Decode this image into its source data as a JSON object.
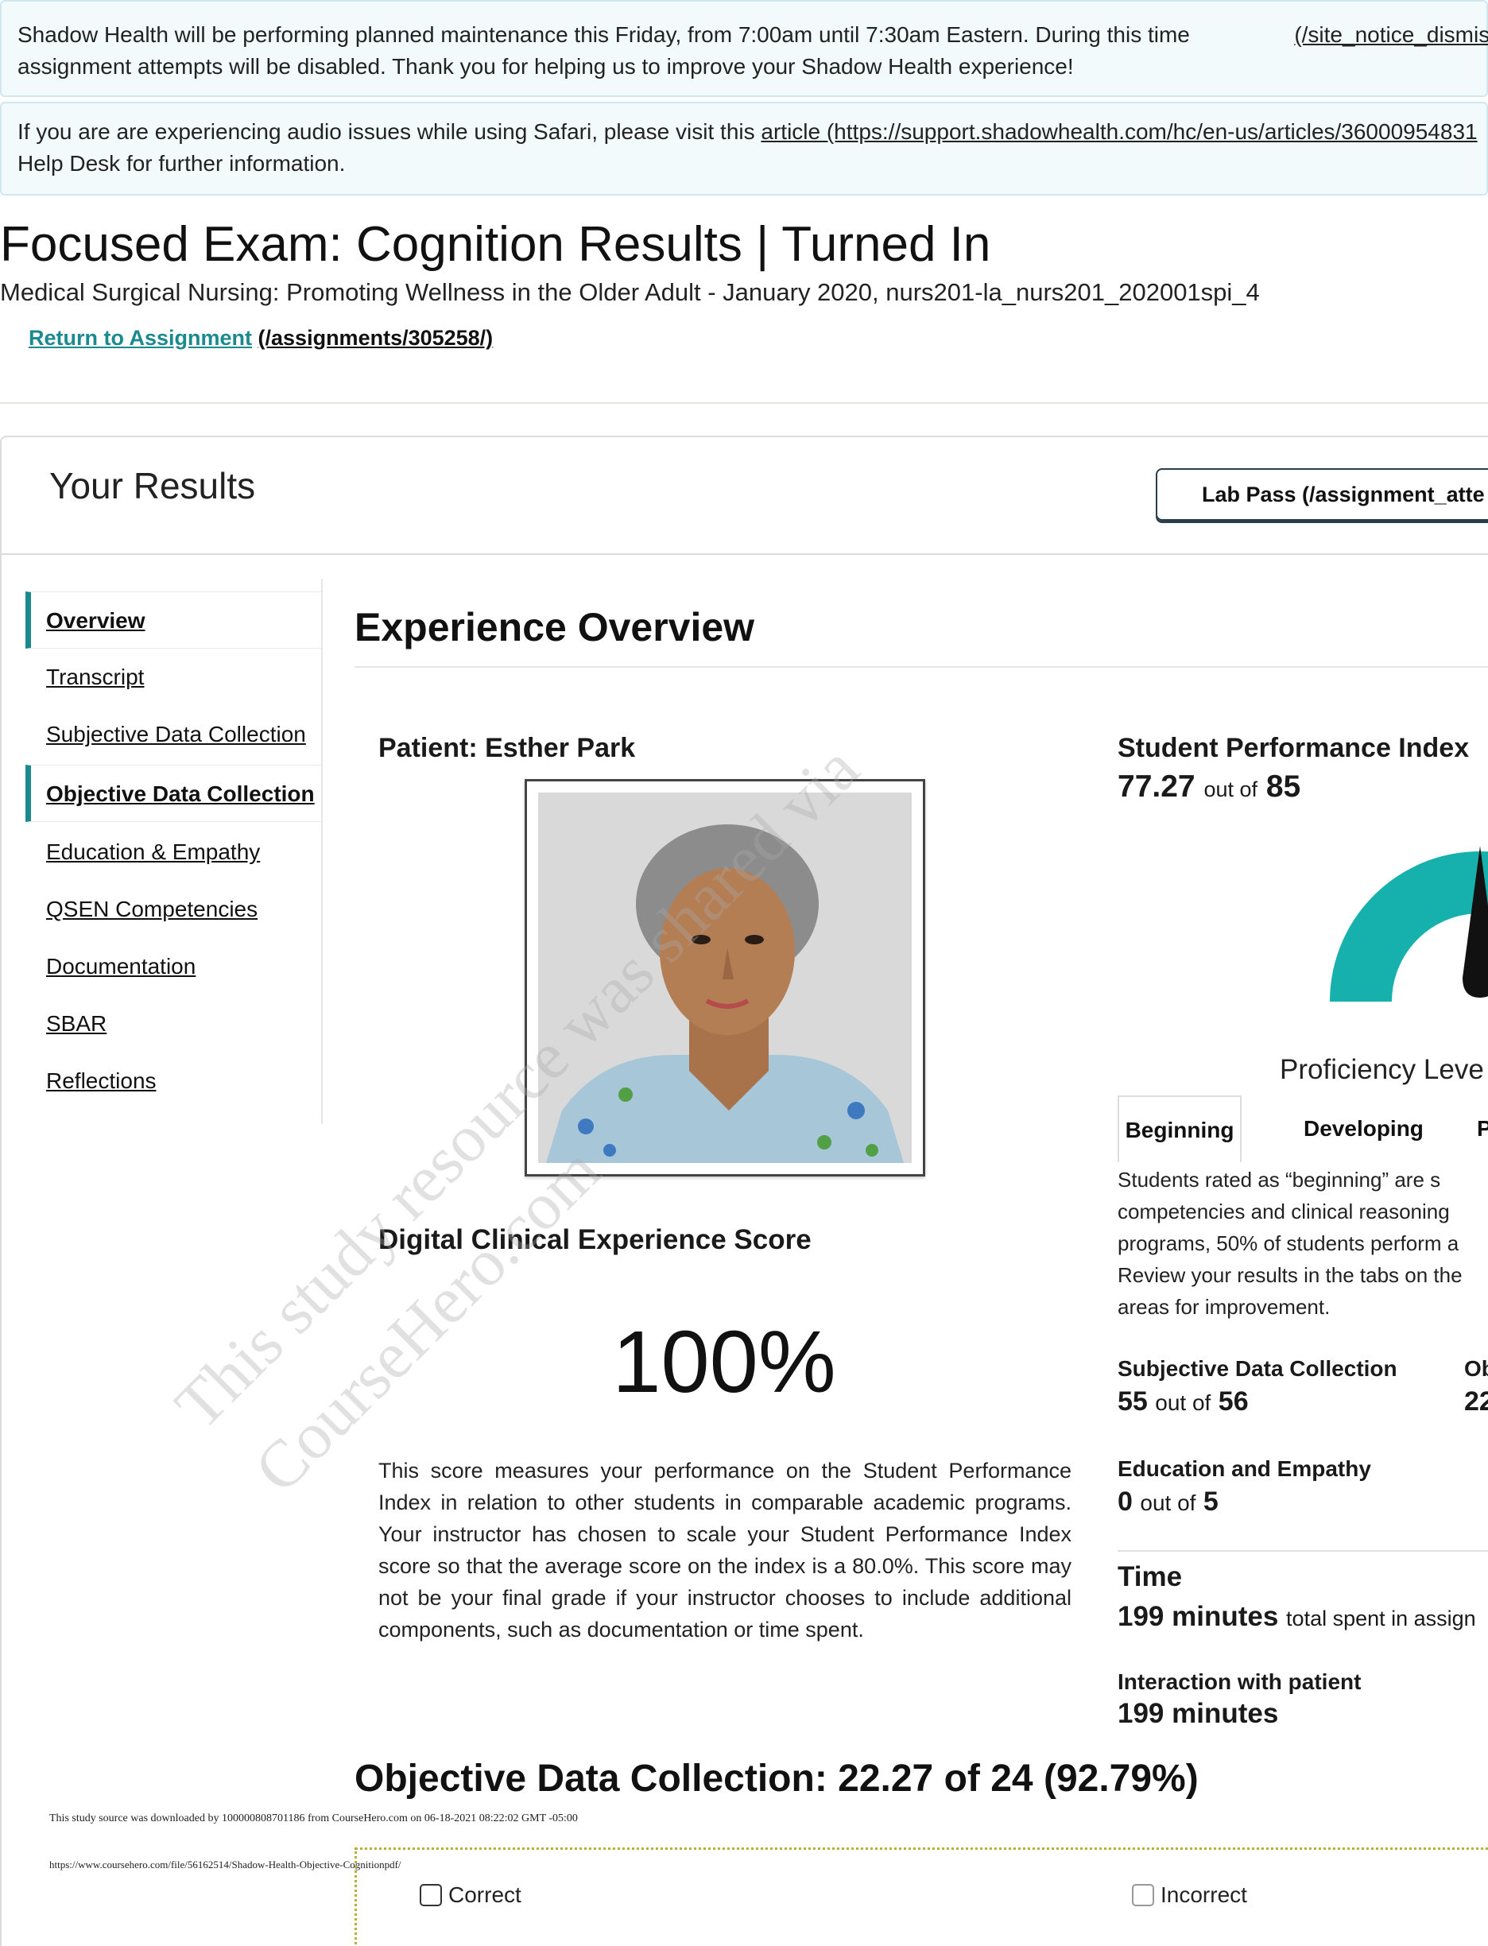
{
  "notices": {
    "maintenance": {
      "text": "Shadow Health will be performing planned maintenance this Friday, from 7:00am until 7:30am Eastern. During this time assignment attempts will be disabled. Thank you for helping us to improve your Shadow Health experience!",
      "dismiss_link": "(/site_notice_dismissal"
    },
    "audio": {
      "text_before": "If you are are experiencing audio issues while using Safari, please visit this ",
      "link_text": "article (https://support.shadowhealth.com/hc/en-us/articles/36000954831",
      "text_after": "Help Desk for further information."
    }
  },
  "page": {
    "title": "Focused Exam: Cognition Results | Turned In",
    "course": "Medical Surgical Nursing: Promoting Wellness in the Older Adult - January 2020, nurs201-la_nurs201_202001spi_4",
    "return_link_label": "Return to Assignment",
    "return_link_url": "(/assignments/305258/)"
  },
  "results": {
    "title": "Your Results",
    "lab_pass_button": "Lab Pass (/assignment_atte"
  },
  "side_nav": [
    {
      "label": "Overview",
      "active": true
    },
    {
      "label": "Transcript",
      "active": false
    },
    {
      "label": "Subjective Data Collection",
      "active": false
    },
    {
      "label": "Objective Data Collection",
      "active": true
    },
    {
      "label": "Education & Empathy",
      "active": false
    },
    {
      "label": "QSEN Competencies",
      "active": false
    },
    {
      "label": "Documentation",
      "active": false
    },
    {
      "label": "SBAR",
      "active": false
    },
    {
      "label": "Reflections",
      "active": false
    }
  ],
  "overview": {
    "title": "Experience Overview",
    "patient_label": "Patient: Esther Park",
    "dce_title": "Digital Clinical Experience Score",
    "dce_score": "100%",
    "dce_description": "This score measures your performance on the Student Performance Index in relation to other students in comparable academic programs. Your instructor has chosen to scale your Student Performance Index score so that the average score on the index is a 80.0%. This score may not be your final grade if your instructor chooses to include additional components, such as documentation or time spent."
  },
  "spi": {
    "title": "Student Performance Index",
    "score": "77.27",
    "out_of_label": "out of",
    "max": "85",
    "gauge_fraction": 0.909,
    "gauge_color": "#17b1ad",
    "proficiency_label": "Proficiency Leve",
    "tabs": [
      "Beginning",
      "Developing",
      "P"
    ],
    "tab_description_lines": [
      "Students rated as “beginning” are s",
      "competencies and clinical reasoning",
      "programs, 50% of students perform a",
      "Review your results in the tabs on the",
      "areas for improvement."
    ]
  },
  "metrics": {
    "subjective": {
      "label": "Subjective Data Collection",
      "score": "55",
      "out_of": "out of",
      "max": "56"
    },
    "objective": {
      "label": "Ob",
      "score": "22"
    },
    "education": {
      "label": "Education and Empathy",
      "score": "0",
      "out_of": "out of",
      "max": "5"
    }
  },
  "time": {
    "title": "Time",
    "total": "199 minutes",
    "total_suffix": "total spent in assign",
    "interaction_label": "Interaction with patient",
    "interaction": "199 minutes"
  },
  "objective_section": {
    "title": "Objective Data Collection: 22.27 of 24 (92.79%)",
    "legend_correct": "Correct",
    "legend_incorrect": "Incorrect"
  },
  "footer": {
    "download_note": "This study source was downloaded by 100000808701186 from CourseHero.com on 06-18-2021 08:22:02 GMT -05:00",
    "source_url": "https://www.coursehero.com/file/56162514/Shadow-Health-Objective-Cognitionpdf/"
  },
  "watermark": {
    "line1": "This study resource was shared via",
    "line2": "CourseHero.com"
  }
}
